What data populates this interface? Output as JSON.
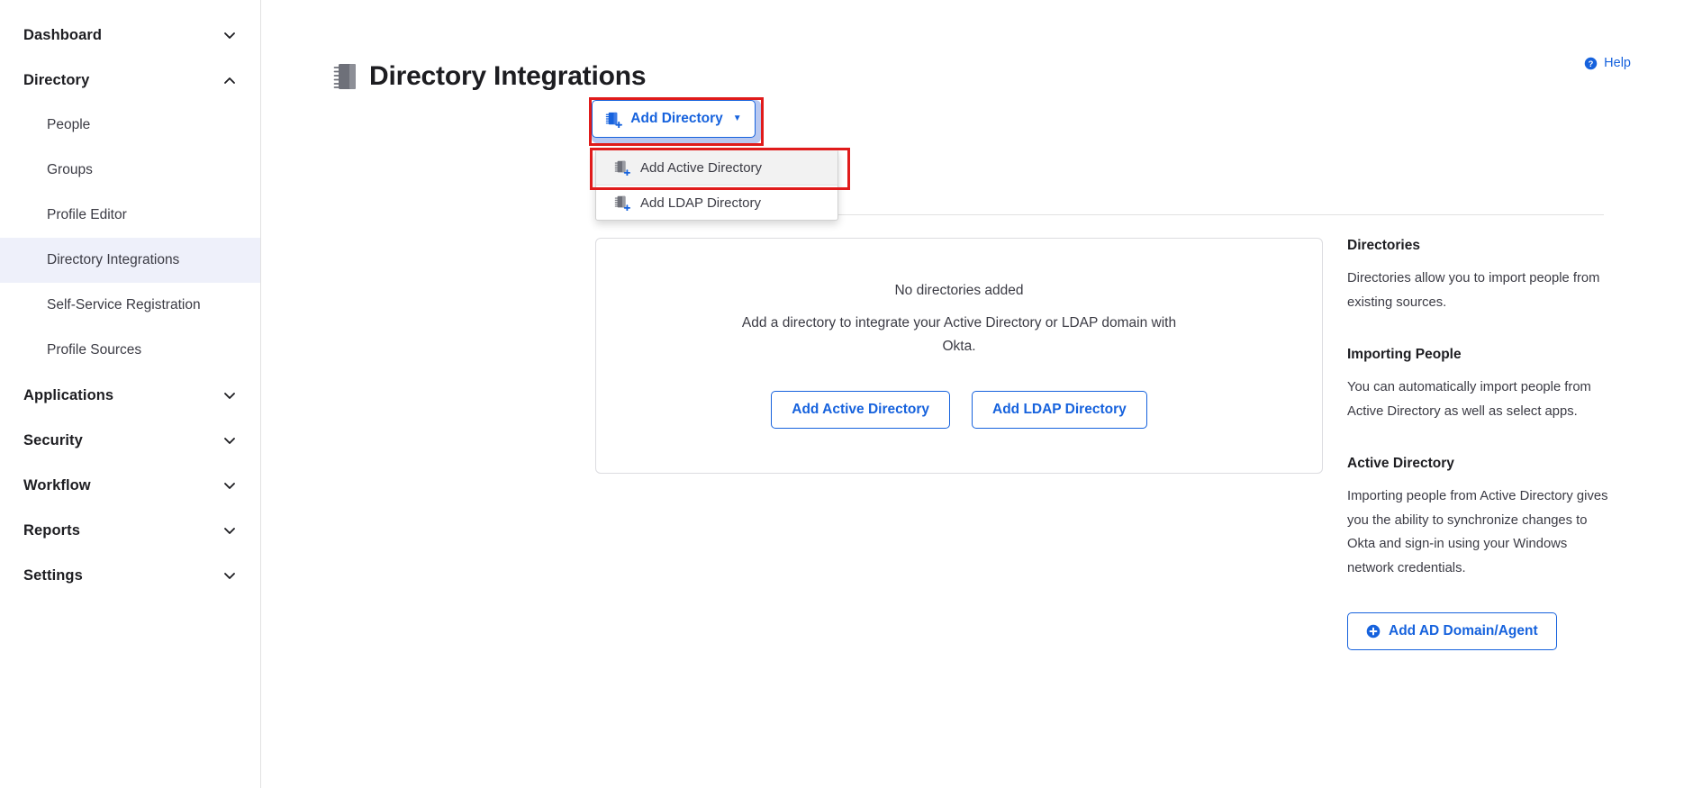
{
  "sidebar": {
    "items": [
      {
        "label": "Dashboard",
        "type": "group",
        "icon": "chevron-down-icon",
        "expanded": false
      },
      {
        "label": "Directory",
        "type": "group",
        "icon": "chevron-up-icon",
        "expanded": true
      },
      {
        "label": "People",
        "type": "sub",
        "active": false
      },
      {
        "label": "Groups",
        "type": "sub",
        "active": false
      },
      {
        "label": "Profile Editor",
        "type": "sub",
        "active": false
      },
      {
        "label": "Directory Integrations",
        "type": "sub",
        "active": true
      },
      {
        "label": "Self-Service Registration",
        "type": "sub",
        "active": false
      },
      {
        "label": "Profile Sources",
        "type": "sub",
        "active": false
      },
      {
        "label": "Applications",
        "type": "group",
        "icon": "chevron-down-icon",
        "expanded": false
      },
      {
        "label": "Security",
        "type": "group",
        "icon": "chevron-down-icon",
        "expanded": false
      },
      {
        "label": "Workflow",
        "type": "group",
        "icon": "chevron-down-icon",
        "expanded": false
      },
      {
        "label": "Reports",
        "type": "group",
        "icon": "chevron-down-icon",
        "expanded": false
      },
      {
        "label": "Settings",
        "type": "group",
        "icon": "chevron-down-icon",
        "expanded": false
      }
    ]
  },
  "header": {
    "title": "Directory Integrations",
    "title_icon": "directory-book-icon",
    "help_label": "Help",
    "help_icon": "question-circle-icon"
  },
  "toolbar": {
    "add_directory_label": "Add Directory",
    "add_directory_icon": "add-directory-icon",
    "caret_icon": "caret-down-icon",
    "focused": true,
    "menu_open": true,
    "menu_items": [
      {
        "label": "Add Active Directory",
        "icon": "add-directory-icon",
        "hovered": true
      },
      {
        "label": "Add LDAP Directory",
        "icon": "add-directory-icon",
        "hovered": false
      }
    ]
  },
  "empty_state": {
    "title": "No directories added",
    "description": "Add a directory to integrate your Active Directory or LDAP domain with Okta.",
    "buttons": [
      {
        "label": "Add Active Directory"
      },
      {
        "label": "Add LDAP Directory"
      }
    ]
  },
  "info_rail": {
    "sections": [
      {
        "heading": "Directories",
        "body": "Directories allow you to import people from existing sources."
      },
      {
        "heading": "Importing People",
        "body": "You can automatically import people from Active Directory as well as select apps."
      },
      {
        "heading": "Active Directory",
        "body": "Importing people from Active Directory gives you the ability to synchronize changes to Okta and sign-in using your Windows network credentials."
      }
    ],
    "ad_agent_button": {
      "label": "Add AD Domain/Agent",
      "icon": "plus-circle-icon"
    }
  },
  "colors": {
    "accent_blue": "#1662dd",
    "annotation_red": "#e01b1b",
    "active_nav_bg": "#eef0fa",
    "focus_ring": "#b8c8f0",
    "text_primary": "#1d1d21",
    "text_secondary": "#3b3b44",
    "border": "#e1e1e1"
  }
}
